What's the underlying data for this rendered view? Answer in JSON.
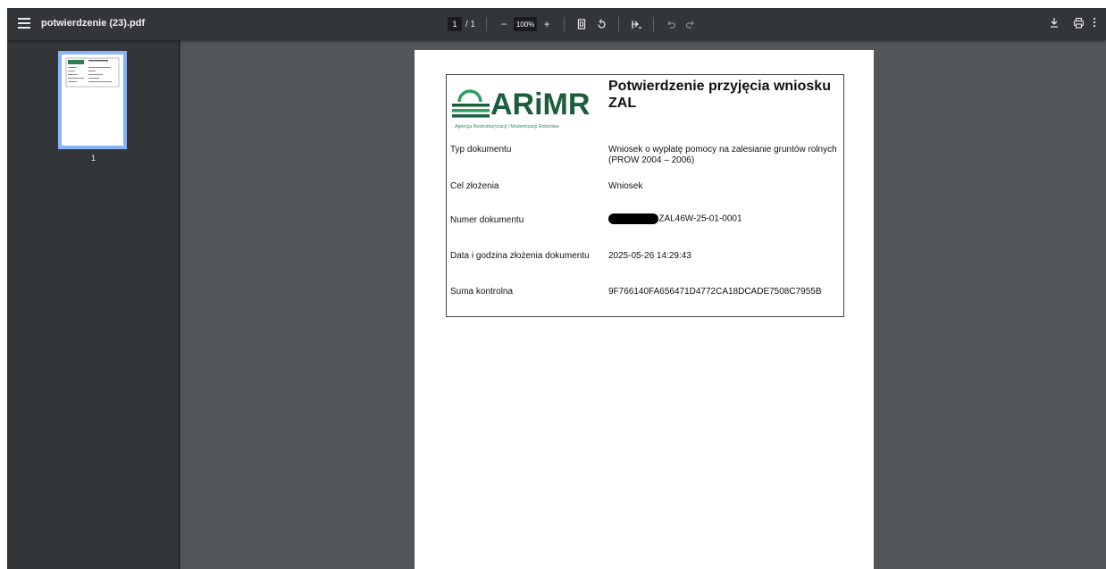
{
  "toolbar": {
    "file_name": "potwierdzenie (23).pdf",
    "page_current": "1",
    "page_total": "/ 1",
    "zoom": "100%",
    "zoom_out_label": "−",
    "zoom_in_label": "+"
  },
  "sidebar": {
    "thumbnail_page_number": "1"
  },
  "document": {
    "logo_text": "ARiMR",
    "logo_subtitle": "Agencja Restrukturyzacji i Modernizacji Rolnictwa",
    "title": "Potwierdzenie przyjęcia wniosku ZAL",
    "rows": [
      {
        "label": "Typ dokumentu",
        "value": "Wniosek o wypłatę pomocy na zalesianie gruntów rolnych (PROW 2004 – 2006)"
      },
      {
        "label": "Cel złożenia",
        "value": "Wniosek"
      },
      {
        "label": "Numer dokumentu",
        "value": "-ZAL46W-25-01-0001"
      },
      {
        "label": "Data i godzina złożenia dokumentu",
        "value": "2025-05-26 14:29:43"
      },
      {
        "label": "Suma kontrolna",
        "value": "9F766140FA656471D4772CA18DCADE7508C7955B"
      }
    ]
  },
  "colors": {
    "toolbar_bg": "#323639",
    "viewer_bg": "#525659",
    "thumb_highlight": "#8ab4f8",
    "logo_green": "#1b5e3b"
  },
  "icons": [
    "menu-icon",
    "fit-page-icon",
    "rotate-icon",
    "annotate-icon",
    "undo-icon",
    "redo-icon",
    "download-icon",
    "print-icon",
    "more-icon"
  ]
}
